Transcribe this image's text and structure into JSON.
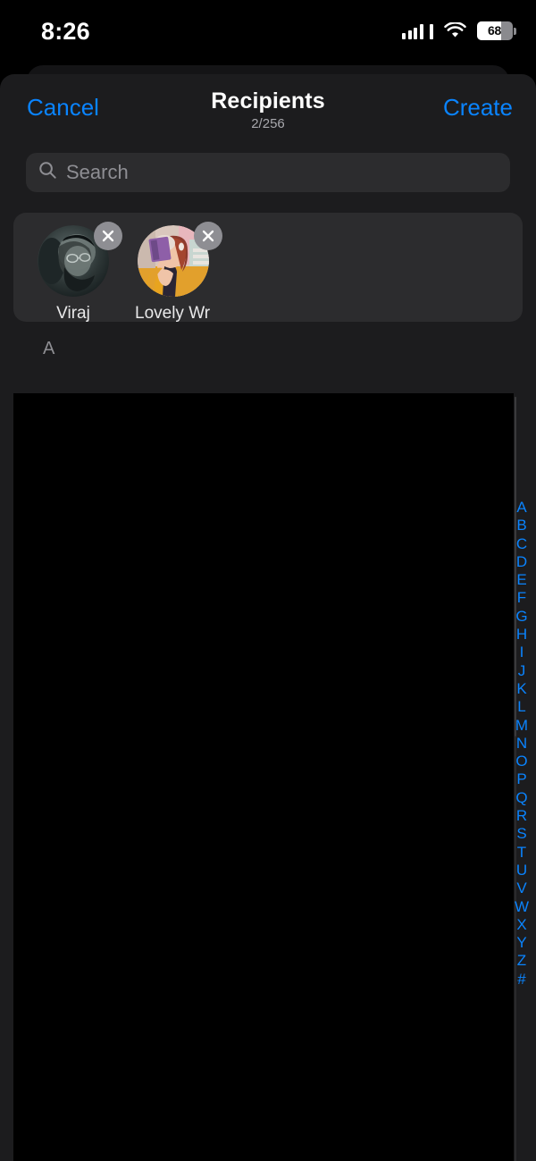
{
  "status_bar": {
    "time": "8:26",
    "cellular_icon": "cellular-bars-icon",
    "wifi_icon": "wifi-icon",
    "battery_icon": "battery-icon",
    "battery_percent": "68",
    "battery_level": 68
  },
  "nav": {
    "cancel_label": "Cancel",
    "title": "Recipients",
    "subtitle": "2/256",
    "create_label": "Create"
  },
  "search": {
    "placeholder": "Search",
    "value": "",
    "icon": "search-icon"
  },
  "recipients": {
    "selected": [
      {
        "name": "Viraj",
        "avatar": "photo-bearded-man-glasses",
        "remove_icon": "close-icon"
      },
      {
        "name": "Lovely Wr…",
        "avatar": "illustration-woman-yellow-cardigan",
        "remove_icon": "close-icon"
      }
    ]
  },
  "contact_list": {
    "section_header": "A",
    "rows": []
  },
  "alpha_index": {
    "letters": [
      "A",
      "B",
      "C",
      "D",
      "E",
      "F",
      "G",
      "H",
      "I",
      "J",
      "K",
      "L",
      "M",
      "N",
      "O",
      "P",
      "Q",
      "R",
      "S",
      "T",
      "U",
      "V",
      "W",
      "X",
      "Y",
      "Z",
      "#"
    ]
  },
  "colors": {
    "accent": "#0a84ff",
    "sheet_bg": "#1c1c1e",
    "field_bg": "#2c2c2e",
    "list_bg": "#000000",
    "secondary_text": "#8e8e93"
  }
}
